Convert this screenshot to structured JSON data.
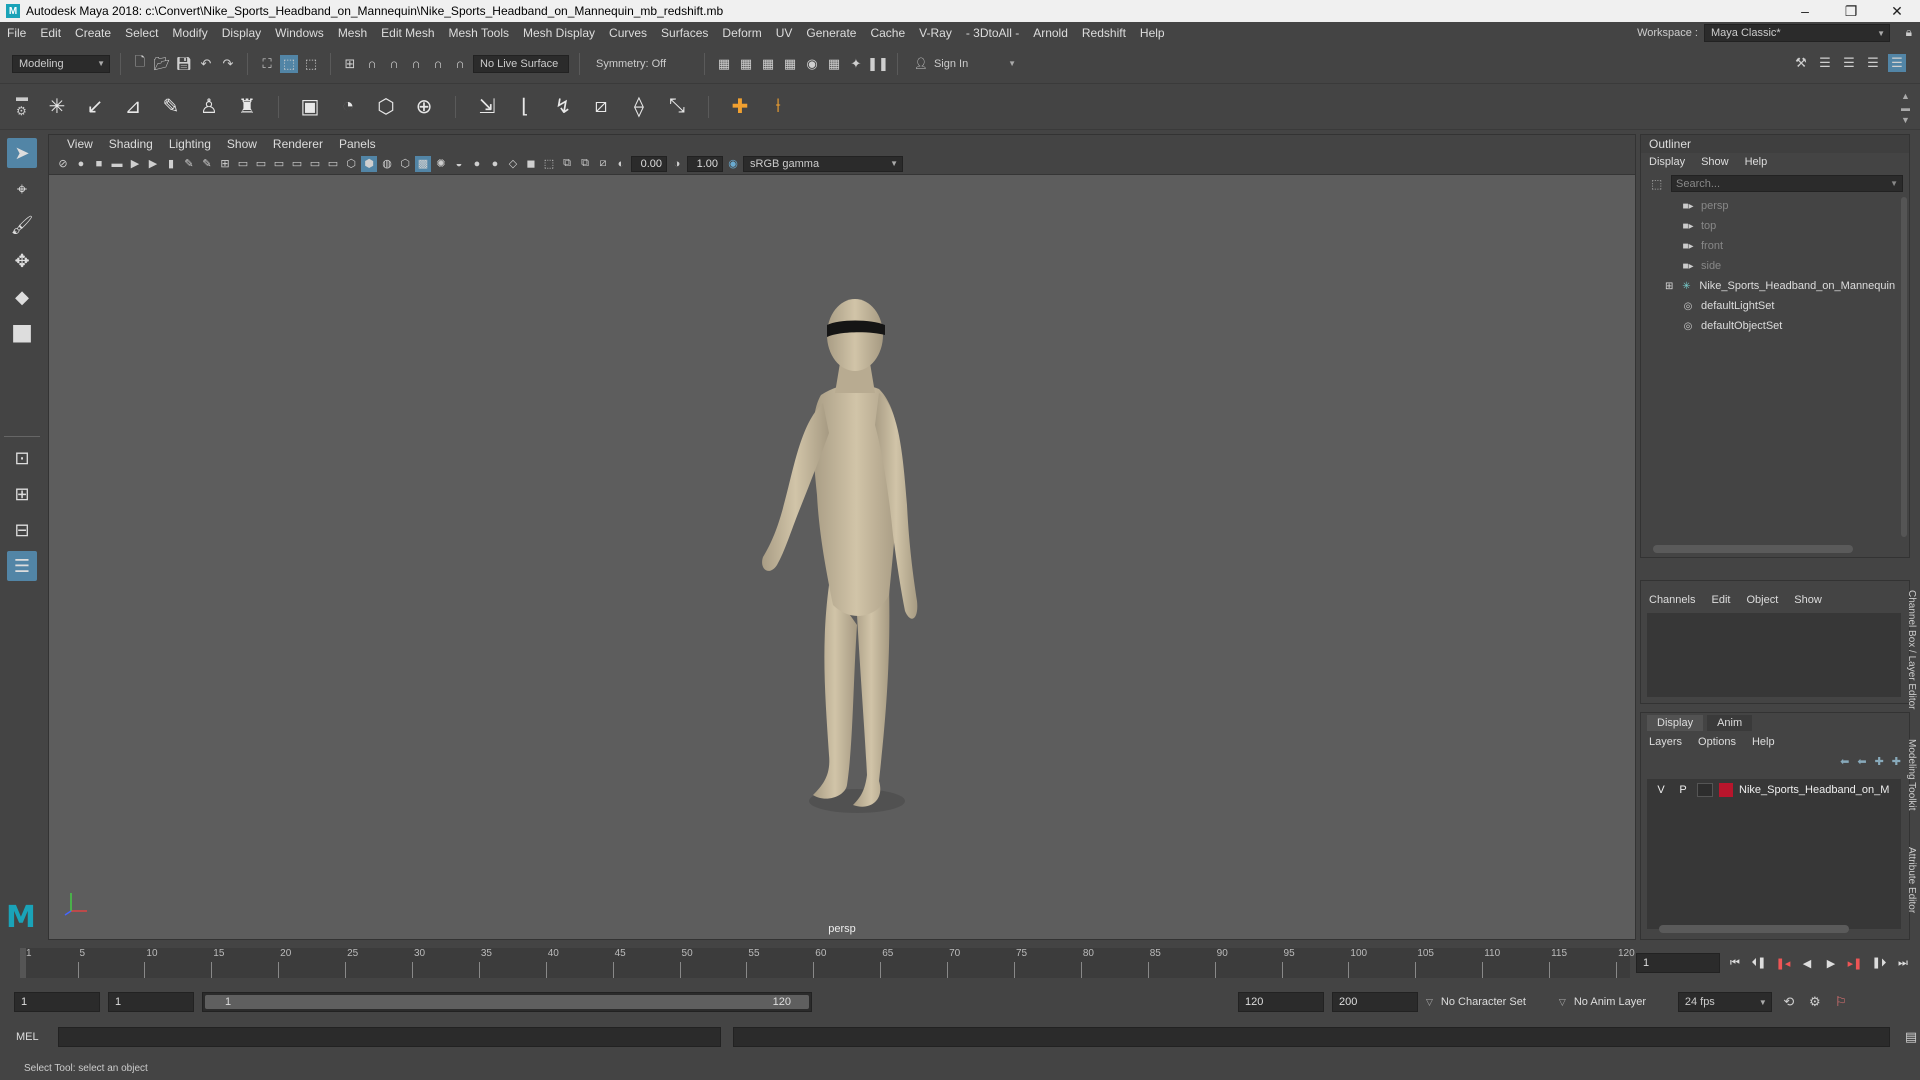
{
  "window": {
    "title": "Autodesk Maya 2018: c:\\Convert\\Nike_Sports_Headband_on_Mannequin\\Nike_Sports_Headband_on_Mannequin_mb_redshift.mb",
    "controls": [
      "–",
      "❐",
      "✕"
    ]
  },
  "menubar": {
    "items": [
      "File",
      "Edit",
      "Create",
      "Select",
      "Modify",
      "Display",
      "Windows",
      "Mesh",
      "Edit Mesh",
      "Mesh Tools",
      "Mesh Display",
      "Curves",
      "Surfaces",
      "Deform",
      "UV",
      "Generate",
      "Cache",
      "V-Ray",
      "- 3DtoAll -",
      "Arnold",
      "Redshift",
      "Help"
    ],
    "workspace_label": "Workspace :",
    "workspace_value": "Maya Classic*"
  },
  "statusline": {
    "mode": "Modeling",
    "live_surface": "No Live Surface",
    "symmetry": "Symmetry: Off",
    "sign_in": "Sign In"
  },
  "viewport": {
    "menu": [
      "View",
      "Shading",
      "Lighting",
      "Show",
      "Renderer",
      "Panels"
    ],
    "exposure": "0.00",
    "gamma": "1.00",
    "colorspace": "sRGB gamma",
    "camera": "persp"
  },
  "outliner": {
    "title": "Outliner",
    "menu": [
      "Display",
      "Show",
      "Help"
    ],
    "search_placeholder": "Search...",
    "items": [
      {
        "label": "persp",
        "icon": "camera-icon",
        "dim": true
      },
      {
        "label": "top",
        "icon": "camera-icon",
        "dim": true
      },
      {
        "label": "front",
        "icon": "camera-icon",
        "dim": true
      },
      {
        "label": "side",
        "icon": "camera-icon",
        "dim": true
      },
      {
        "label": "Nike_Sports_Headband_on_Mannequin",
        "icon": "transform-icon",
        "dim": false
      },
      {
        "label": "defaultLightSet",
        "icon": "set-icon",
        "dim": false
      },
      {
        "label": "defaultObjectSet",
        "icon": "set-icon",
        "dim": false
      }
    ]
  },
  "channelbox": {
    "menu": [
      "Channels",
      "Edit",
      "Object",
      "Show"
    ]
  },
  "layer_editor": {
    "tabs": [
      "Display",
      "Anim"
    ],
    "menu": [
      "Layers",
      "Options",
      "Help"
    ],
    "layer": {
      "v": "V",
      "p": "P",
      "name": "Nike_Sports_Headband_on_M",
      "color": "#b8152c"
    }
  },
  "side_tabs": [
    "Channel Box / Layer Editor",
    "Modeling Toolkit",
    "Attribute Editor"
  ],
  "timeline": {
    "ticks": [
      "1",
      "5",
      "10",
      "15",
      "20",
      "25",
      "30",
      "35",
      "40",
      "45",
      "50",
      "55",
      "60",
      "65",
      "70",
      "75",
      "80",
      "85",
      "90",
      "95",
      "100",
      "105",
      "110",
      "115",
      "120"
    ],
    "current_frame": "1"
  },
  "range": {
    "start": "1",
    "playback_start": "1",
    "slider_start": "1",
    "slider_end": "120",
    "playback_end": "120",
    "end": "200",
    "character_set": "No Character Set",
    "anim_layer": "No Anim Layer",
    "fps": "24 fps"
  },
  "cmdline": {
    "label": "MEL"
  },
  "helpline": {
    "text": "Select Tool: select an object"
  }
}
